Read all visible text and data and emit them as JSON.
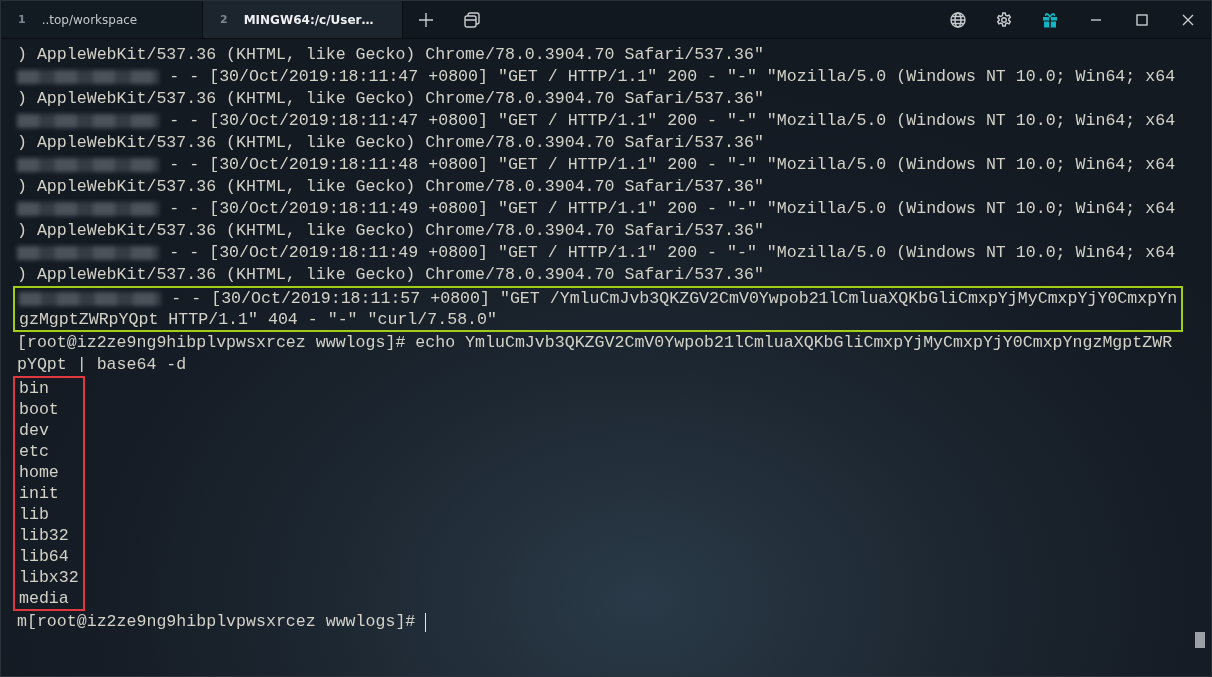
{
  "tabs": [
    {
      "number": "1",
      "label": "..top/workspace",
      "selected": false
    },
    {
      "number": "2",
      "label": "MINGW64:/c/User…",
      "selected": true
    }
  ],
  "terminal": {
    "lines": [
      {
        "text": ") AppleWebKit/537.36 (KHTML, like Gecko) Chrome/78.0.3904.70 Safari/537.36\"",
        "redacted": false
      },
      {
        "text": "- - [30/Oct/2019:18:11:47 +0800] \"GET / HTTP/1.1\" 200 - \"-\" \"Mozilla/5.0 (Windows NT 10.0; Win64; x64",
        "redacted": true
      },
      {
        "text": ") AppleWebKit/537.36 (KHTML, like Gecko) Chrome/78.0.3904.70 Safari/537.36\"",
        "redacted": false
      },
      {
        "text": "- - [30/Oct/2019:18:11:47 +0800] \"GET / HTTP/1.1\" 200 - \"-\" \"Mozilla/5.0 (Windows NT 10.0; Win64; x64",
        "redacted": true
      },
      {
        "text": ") AppleWebKit/537.36 (KHTML, like Gecko) Chrome/78.0.3904.70 Safari/537.36\"",
        "redacted": false
      },
      {
        "text": "- - [30/Oct/2019:18:11:48 +0800] \"GET / HTTP/1.1\" 200 - \"-\" \"Mozilla/5.0 (Windows NT 10.0; Win64; x64",
        "redacted": true
      },
      {
        "text": ") AppleWebKit/537.36 (KHTML, like Gecko) Chrome/78.0.3904.70 Safari/537.36\"",
        "redacted": false
      },
      {
        "text": "- - [30/Oct/2019:18:11:49 +0800] \"GET / HTTP/1.1\" 200 - \"-\" \"Mozilla/5.0 (Windows NT 10.0; Win64; x64",
        "redacted": true
      },
      {
        "text": ") AppleWebKit/537.36 (KHTML, like Gecko) Chrome/78.0.3904.70 Safari/537.36\"",
        "redacted": false
      },
      {
        "text": "- - [30/Oct/2019:18:11:49 +0800] \"GET / HTTP/1.1\" 200 - \"-\" \"Mozilla/5.0 (Windows NT 10.0; Win64; x64",
        "redacted": true
      },
      {
        "text": ") AppleWebKit/537.36 (KHTML, like Gecko) Chrome/78.0.3904.70 Safari/537.36\"",
        "redacted": false
      },
      {
        "text": "- - [30/Oct/2019:18:11:57 +0800] \"GET /YmluCmJvb3QKZGV2CmV0Ywpob21lCmluaXQKbGliCmxpYjMyCmxpYjY0CmxpYn",
        "redacted": true,
        "color": "#a2cc16"
      },
      {
        "text": "gzMgptZWRpYQpt HTTP/1.1\" 404 - \"-\" \"curl/7.58.0\"",
        "redacted": false,
        "color": "#a2cc16"
      },
      {
        "text": "[root@iz2ze9ng9hibplvpwsxrcez wwwlogs]# echo YmluCmJvb3QKZGV2CmV0Ywpob21lCmluaXQKbGliCmxpYjMyCmxpYjY0CmxpYngzMgptZWR",
        "redacted": false
      },
      {
        "text": "pYQpt | base64 -d",
        "redacted": false
      },
      {
        "text": "bin",
        "redacted": false,
        "color": "#e0383e"
      },
      {
        "text": "boot",
        "redacted": false,
        "color": "#e0383e"
      },
      {
        "text": "dev",
        "redacted": false,
        "color": "#e0383e"
      },
      {
        "text": "etc",
        "redacted": false,
        "color": "#e0383e"
      },
      {
        "text": "home",
        "redacted": false,
        "color": "#e0383e"
      },
      {
        "text": "init",
        "redacted": false,
        "color": "#e0383e"
      },
      {
        "text": "lib",
        "redacted": false,
        "color": "#e0383e"
      },
      {
        "text": "lib32",
        "redacted": false,
        "color": "#e0383e"
      },
      {
        "text": "lib64",
        "redacted": false,
        "color": "#e0383e"
      },
      {
        "text": "libx32",
        "redacted": false,
        "color": "#e0383e"
      },
      {
        "text": "media",
        "redacted": false,
        "color": "#e0383e"
      },
      {
        "text": "m[root@iz2ze9ng9hibplvpwsxrcez wwwlogs]# ",
        "redacted": false,
        "cursor": true
      }
    ]
  }
}
